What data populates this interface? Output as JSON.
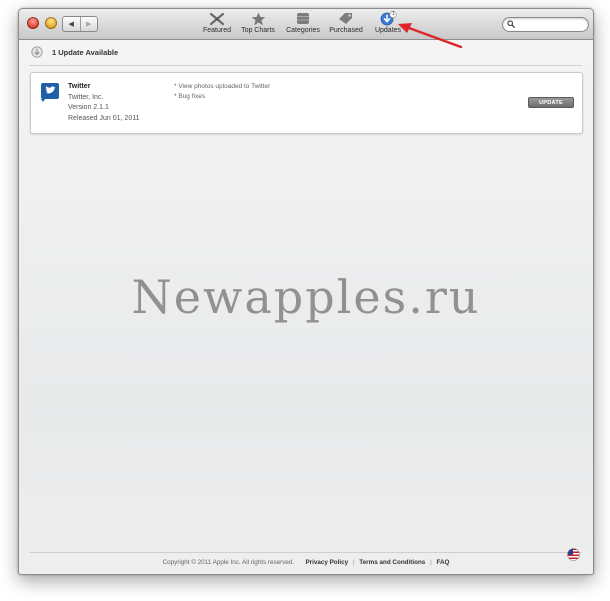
{
  "toolbar": {
    "items": [
      {
        "label": "Featured",
        "icon": "featured-icon"
      },
      {
        "label": "Top Charts",
        "icon": "star-icon"
      },
      {
        "label": "Categories",
        "icon": "categories-icon"
      },
      {
        "label": "Purchased",
        "icon": "purchased-tag-icon"
      },
      {
        "label": "Updates",
        "icon": "updates-icon",
        "badge": "1",
        "active": true
      }
    ],
    "search_value": ""
  },
  "updates_header": {
    "text": "1 Update Available"
  },
  "update_item": {
    "name": "Twitter",
    "developer": "Twitter, Inc.",
    "version": "Version 2.1.1",
    "released": "Released Jun 01, 2011",
    "notes": [
      "* View photos uploaded to Twitter",
      "* Bug fixes"
    ],
    "button_label": "UPDATE"
  },
  "watermark": "Newapples.ru",
  "footer": {
    "copyright": "Copyright © 2011 Apple Inc. All rights reserved.",
    "links": [
      "Privacy Policy",
      "Terms and Conditions",
      "FAQ"
    ]
  },
  "colors": {
    "annotation_arrow": "#e0242a",
    "updates_accent": "#3b7bd6"
  }
}
